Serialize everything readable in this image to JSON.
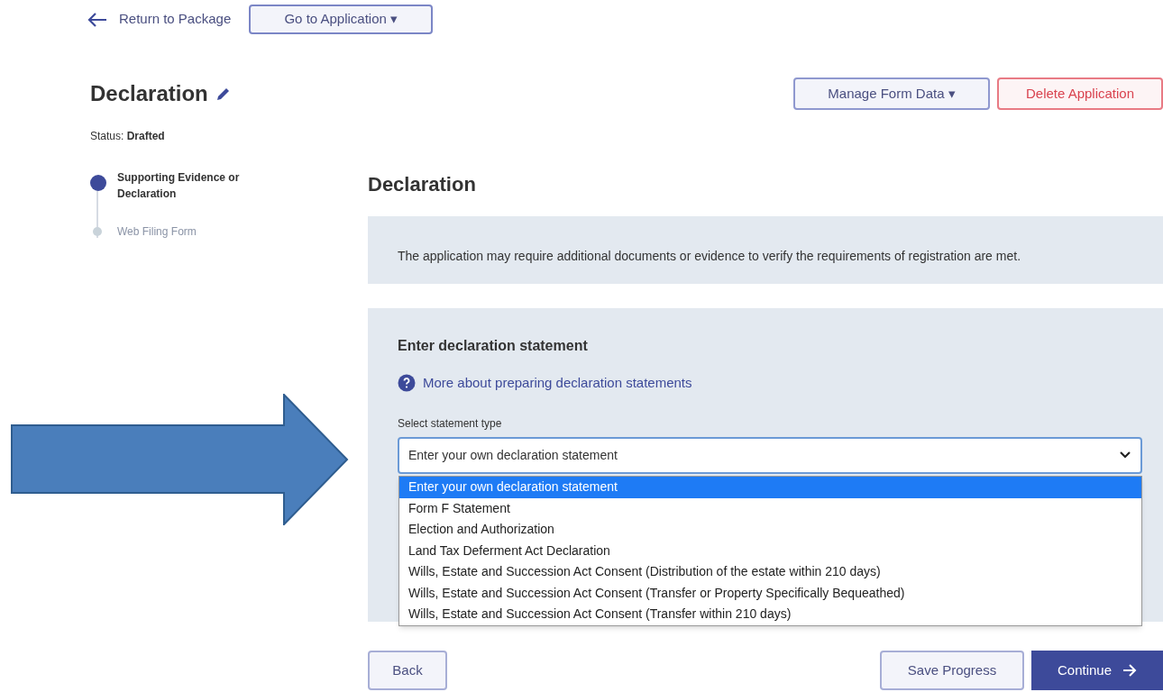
{
  "top_nav": {
    "back_link": "Return to Package",
    "app_menu": "Go to Application ▾"
  },
  "header": {
    "title": "Declaration",
    "status_label": "Status:",
    "status_value": "Drafted",
    "buttons": [
      {
        "label": "Manage Form Data ▾",
        "kind": "outline"
      },
      {
        "label": "Delete Application",
        "kind": "danger"
      }
    ]
  },
  "steps": [
    {
      "label": "Supporting Evidence or Declaration",
      "selected": true
    },
    {
      "label": "Web Filing Form",
      "selected": false
    }
  ],
  "main": {
    "heading": "Declaration",
    "info_text": "The application may require additional documents or evidence to verify the requirements of registration are met.",
    "section_heading": "Enter declaration statement",
    "help_link": "More about preparing declaration statements",
    "select_label": "Select statement type",
    "select_value": "Enter your own declaration statement",
    "options": [
      {
        "label": "Enter your own declaration statement",
        "selected": true
      },
      {
        "label": "Form F Statement",
        "selected": false
      },
      {
        "label": "Election and Authorization",
        "selected": false
      },
      {
        "label": "Land Tax Deferment Act Declaration",
        "selected": false
      },
      {
        "label": "Wills, Estate and Succession Act Consent (Distribution of the estate within 210 days)",
        "selected": false
      },
      {
        "label": "Wills, Estate and Succession Act Consent (Transfer or Property Specifically Bequeathed)",
        "selected": false
      },
      {
        "label": "Wills, Estate and Succession Act Consent (Transfer within 210 days)",
        "selected": false
      }
    ]
  },
  "footer": {
    "back": "Back",
    "save": "Save Progress",
    "continue": "Continue"
  }
}
